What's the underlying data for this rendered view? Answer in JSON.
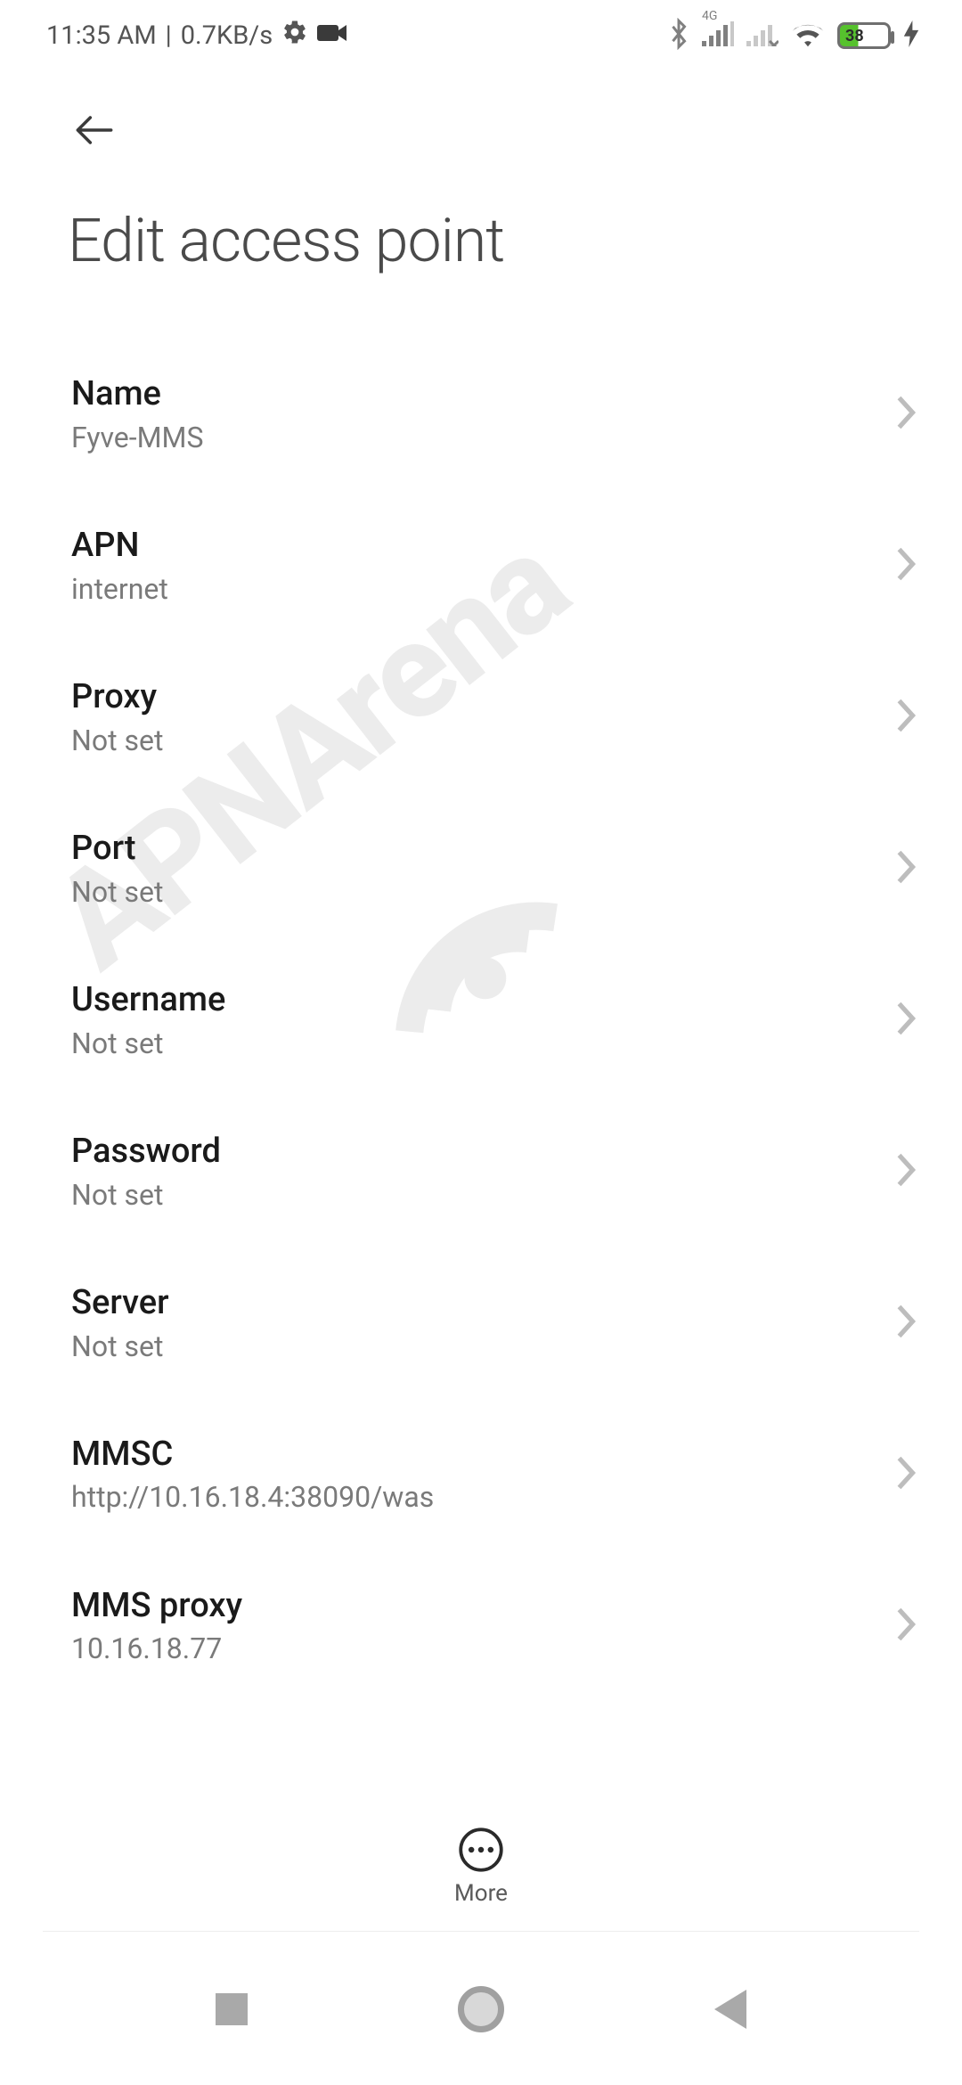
{
  "status": {
    "time": "11:35 AM",
    "sep": "|",
    "speed": "0.7KB/s",
    "network_label": "4G",
    "battery_percent": "38"
  },
  "header": {
    "title": "Edit access point"
  },
  "items": [
    {
      "label": "Name",
      "value": "Fyve-MMS"
    },
    {
      "label": "APN",
      "value": "internet"
    },
    {
      "label": "Proxy",
      "value": "Not set"
    },
    {
      "label": "Port",
      "value": "Not set"
    },
    {
      "label": "Username",
      "value": "Not set"
    },
    {
      "label": "Password",
      "value": "Not set"
    },
    {
      "label": "Server",
      "value": "Not set"
    },
    {
      "label": "MMSC",
      "value": "http://10.16.18.4:38090/was"
    },
    {
      "label": "MMS proxy",
      "value": "10.16.18.77"
    }
  ],
  "bottom": {
    "more_label": "More"
  },
  "watermark_text": "APNArena"
}
